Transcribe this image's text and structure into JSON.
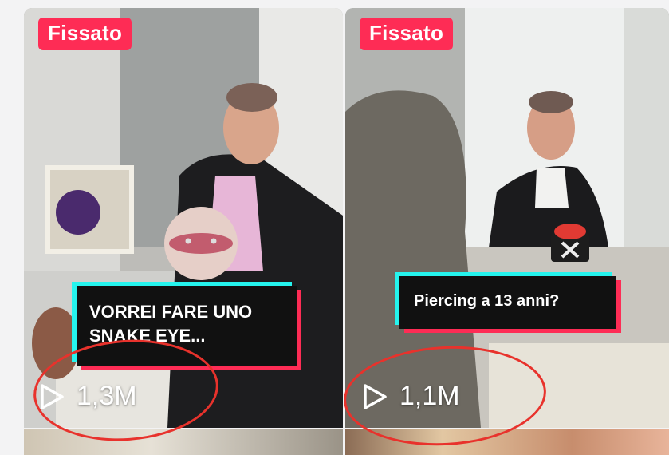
{
  "videos": [
    {
      "pinned_label": "Fissato",
      "caption": "VORREI FARE UNO SNAKE EYE...",
      "views": "1,3M"
    },
    {
      "pinned_label": "Fissato",
      "caption": "Piercing a 13 anni?",
      "views": "1,1M"
    }
  ],
  "colors": {
    "badge": "#fe2c55",
    "caption_shadow_cyan": "#25f4ee",
    "caption_shadow_pink": "#fe2c55",
    "annotation_ring": "#e8322c"
  },
  "icons": [
    "play-icon",
    "annotation-ring"
  ]
}
